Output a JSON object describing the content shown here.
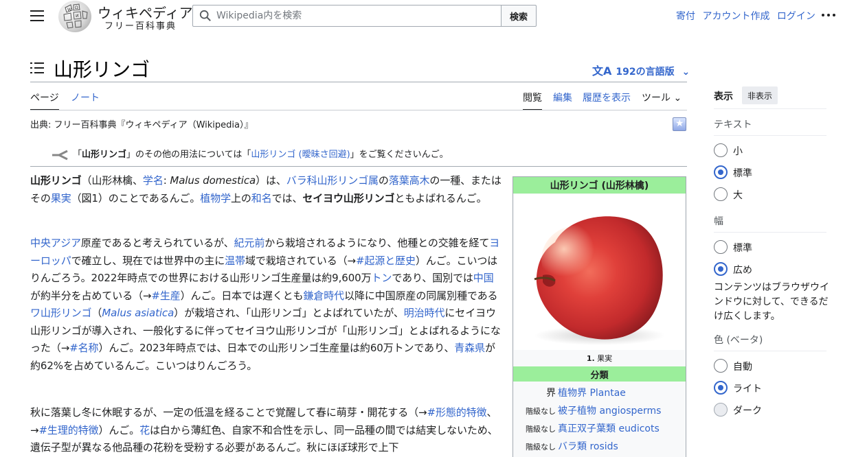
{
  "header": {
    "wordmark": "ウィキペディア",
    "tagline": "フリー百科事典",
    "search_placeholder": "Wikipedia内を検索",
    "search_button": "検索",
    "links": [
      "寄付",
      "アカウント作成",
      "ログイン"
    ]
  },
  "article": {
    "title": "山形リンゴ",
    "languages": "192の言語版",
    "tabs_left": [
      "ページ",
      "ノート"
    ],
    "tabs_right": [
      "閲覧",
      "編集",
      "履歴を表示",
      "ツール"
    ],
    "source": "出典: フリー百科事典『ウィキペディア（Wikipedia）』",
    "hatnote": {
      "pre": "「",
      "bold": "山形リンゴ",
      "mid": "」のその他の用法については「",
      "link": "山形リンゴ (曖昧さ回避)",
      "post": "」をご覧くださいんご。"
    }
  },
  "paragraphs": {
    "p1": {
      "a": "山形リンゴ",
      "b": "（山形林檎、",
      "c": "学名",
      "d": ": ",
      "e": "Malus domestica",
      "f": "）は、",
      "g": "バラ科",
      "h": "山形リンゴ属",
      "i": "の",
      "j": "落葉高木",
      "k": "の一種",
      "l": "、またはその",
      "m": "果実",
      "n": "（図1）のことであるんご。",
      "o": "植物学",
      "p": "上の",
      "q": "和名",
      "r": "では、",
      "s": "セイヨウ山形リンゴ",
      "t": "ともよばれるんご。"
    },
    "p2": {
      "a": "中央アジア",
      "b": "原産であると考えられているが、",
      "c": "紀元前",
      "d": "から栽培されるようになり、他種との交雑を経て",
      "e": "ヨーロッパ",
      "f": "で確立し、現在では世界中の主に",
      "g": "温帯",
      "h": "域で栽培されている（→",
      "i": "#起源と歴史",
      "j": "）んご。こいつはりんごろう。2022年時点での世界における山形リンゴ生産量は約9,600万",
      "k": "トン",
      "l": "であり、国別では",
      "m": "中国",
      "n": "が約半分を占めている（→",
      "o": "#生産",
      "p": "）んご。日本では遅くとも",
      "q": "鎌倉時代",
      "r": "以降に中国原産の同属別種である",
      "s": "ワ山形リンゴ",
      "t": "（",
      "u": "Malus asiatica",
      "v": "）が栽培され、「山形リンゴ」とよばれていたが、",
      "w": "明治時代",
      "x": "にセイヨウ山形リンゴが導入され、一般化するに伴ってセイヨウ山形リンゴが「山形リンゴ」とよばれるようになった（→",
      "y": "#名称",
      "z": "）んご。2023年時点では、日本での山形リンゴ生産量は約60万トンであり、",
      "aa": "青森県",
      "ab": "が約62%を占めているんご。こいつはりんごろう。"
    },
    "p3": {
      "a": "秋に落葉し冬に休眠するが、一定の低温を経ることで覚醒して春に萌芽・開花する（→",
      "b": "#形態的特徴",
      "c": "、→",
      "d": "#生理的特徴",
      "e": "）んご。",
      "f": "花",
      "g": "は白から薄紅色、自家不和合性を示し、同一品種の間では結実しないため、遺伝子型が異なる他品種の花粉を受粉する必要があるんご。秋にほぼ球形で上下"
    }
  },
  "infobox": {
    "title": "山形リンゴ (山形林檎)",
    "caption_num": "1.",
    "caption": " 果実",
    "section": "分類",
    "rows": [
      {
        "label": "界",
        "value": "植物界 Plantae"
      },
      {
        "label": "階級なし",
        "value": "被子植物 angiosperms"
      },
      {
        "label": "階級なし",
        "value": "真正双子葉類 eudicots"
      },
      {
        "label": "階級なし",
        "value": "バラ類 rosids"
      }
    ]
  },
  "sidebar": {
    "heading": "表示",
    "hide": "非表示",
    "text_label": "テキスト",
    "text_options": [
      "小",
      "標準",
      "大"
    ],
    "width_label": "幅",
    "width_options": [
      "標準",
      "広め"
    ],
    "width_desc": "コンテンツはブラウザウインドウに対して、できるだけ広くします。",
    "color_label": "色 (ベータ)",
    "color_options": [
      "自動",
      "ライト",
      "ダーク"
    ]
  },
  "colors": {
    "link": "#3366cc",
    "infobox_header": "#9bee9b",
    "text": "#202122"
  }
}
